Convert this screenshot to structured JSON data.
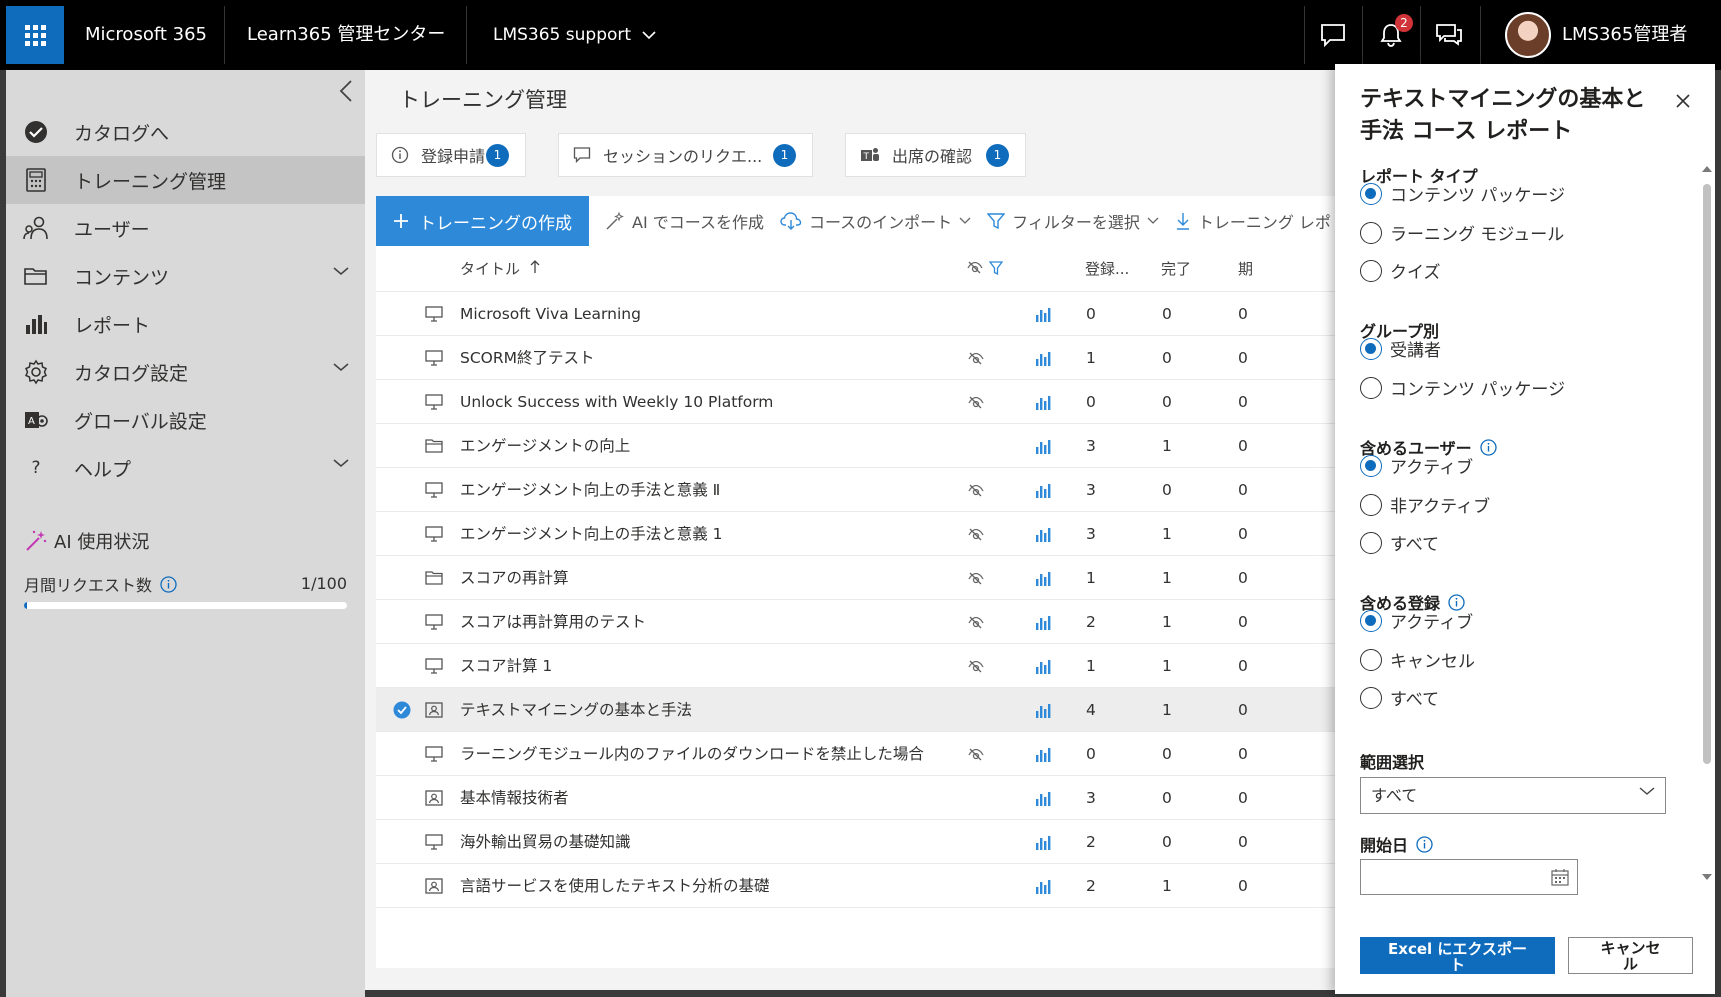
{
  "topbar": {
    "app": "Microsoft 365",
    "center": "Learn365 管理センター",
    "tenant": "LMS365 support",
    "notifications": "2",
    "user": "LMS365管理者"
  },
  "sidebar": {
    "items": [
      {
        "label": "カタログへ",
        "icon": "check-circle-icon"
      },
      {
        "label": "トレーニング管理",
        "icon": "calculator-icon"
      },
      {
        "label": "ユーザー",
        "icon": "users-icon"
      },
      {
        "label": "コンテンツ",
        "icon": "folder-icon"
      },
      {
        "label": "レポート",
        "icon": "bar-chart-icon"
      },
      {
        "label": "カタログ設定",
        "icon": "gear-icon"
      },
      {
        "label": "グローバル設定",
        "icon": "global-settings-icon"
      },
      {
        "label": "ヘルプ",
        "icon": "help-icon"
      }
    ],
    "ai_title": "AI 使用状況",
    "request_label": "月間リクエスト数",
    "request_count": "1/100",
    "request_progress": 0.01
  },
  "main": {
    "title": "トレーニング管理",
    "pills": [
      {
        "label": "登録申請",
        "count": "1"
      },
      {
        "label": "セッションのリクエ...",
        "count": "1"
      },
      {
        "label": "出席の確認",
        "count": "1"
      }
    ],
    "commands": {
      "create": "トレーニングの作成",
      "ai_create": "AI でコースを作成",
      "import": "コースのインポート",
      "filter": "フィルターを選択",
      "download": "トレーニング レポ"
    },
    "columns": {
      "title": "タイトル",
      "enrolled": "登録...",
      "completed": "完了",
      "extra": "期"
    },
    "rows": [
      {
        "title": "Microsoft Viva Learning",
        "type": "monitor",
        "hidden": false,
        "enrolled": "0",
        "completed": "0",
        "extra": "0"
      },
      {
        "title": "SCORM終了テスト",
        "type": "monitor",
        "hidden": true,
        "enrolled": "1",
        "completed": "0",
        "extra": "0"
      },
      {
        "title": "Unlock Success with Weekly 10 Platform",
        "type": "monitor",
        "hidden": true,
        "enrolled": "0",
        "completed": "0",
        "extra": "0"
      },
      {
        "title": "エンゲージメントの向上",
        "type": "folder",
        "hidden": false,
        "enrolled": "3",
        "completed": "1",
        "extra": "0"
      },
      {
        "title": "エンゲージメント向上の手法と意義 Ⅱ",
        "type": "monitor",
        "hidden": true,
        "enrolled": "3",
        "completed": "0",
        "extra": "0"
      },
      {
        "title": "エンゲージメント向上の手法と意義 1",
        "type": "monitor",
        "hidden": true,
        "enrolled": "3",
        "completed": "1",
        "extra": "0"
      },
      {
        "title": "スコアの再計算",
        "type": "folder",
        "hidden": true,
        "enrolled": "1",
        "completed": "1",
        "extra": "0"
      },
      {
        "title": "スコアは再計算用のテスト",
        "type": "monitor",
        "hidden": true,
        "enrolled": "2",
        "completed": "1",
        "extra": "0"
      },
      {
        "title": "スコア計算 1",
        "type": "monitor",
        "hidden": true,
        "enrolled": "1",
        "completed": "1",
        "extra": "0"
      },
      {
        "title": "テキストマイニングの基本と手法",
        "type": "classroom",
        "hidden": false,
        "enrolled": "4",
        "completed": "1",
        "extra": "0",
        "selected": true
      },
      {
        "title": "ラーニングモジュール内のファイルのダウンロードを禁止した場合",
        "type": "monitor",
        "hidden": true,
        "enrolled": "0",
        "completed": "0",
        "extra": "0"
      },
      {
        "title": "基本情報技術者",
        "type": "classroom",
        "hidden": false,
        "enrolled": "3",
        "completed": "0",
        "extra": "0"
      },
      {
        "title": "海外輸出貿易の基礎知識",
        "type": "monitor",
        "hidden": false,
        "enrolled": "2",
        "completed": "0",
        "extra": "0"
      },
      {
        "title": "言語サービスを使用したテキスト分析の基礎",
        "type": "classroom",
        "hidden": false,
        "enrolled": "2",
        "completed": "1",
        "extra": "0"
      }
    ]
  },
  "panel": {
    "title": "テキストマイニングの基本と手法 コース レポート",
    "report_type": {
      "label": "レポート タイプ",
      "options": [
        "コンテンツ パッケージ",
        "ラーニング モジュール",
        "クイズ"
      ],
      "selected": 0
    },
    "group_by": {
      "label": "グループ別",
      "options": [
        "受講者",
        "コンテンツ パッケージ"
      ],
      "selected": 0
    },
    "include_users": {
      "label": "含めるユーザー",
      "options": [
        "アクティブ",
        "非アクティブ",
        "すべて"
      ],
      "selected": 0
    },
    "include_enroll": {
      "label": "含める登録",
      "options": [
        "アクティブ",
        "キャンセル",
        "すべて"
      ],
      "selected": 0
    },
    "range": {
      "label": "範囲選択",
      "value": "すべて"
    },
    "start_date": {
      "label": "開始日",
      "value": ""
    },
    "export": "Excel にエクスポート",
    "cancel": "キャンセル"
  }
}
